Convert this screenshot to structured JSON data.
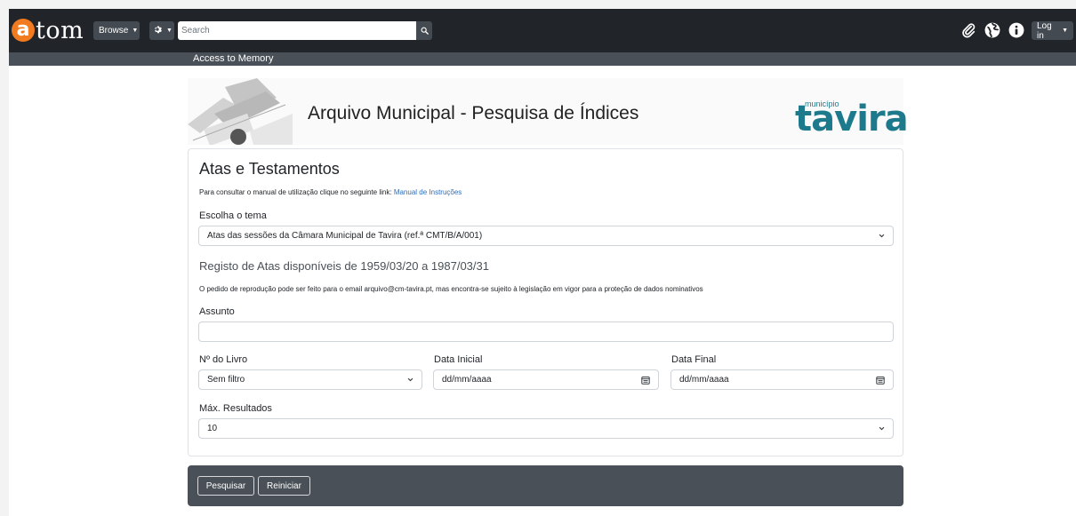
{
  "navbar": {
    "logo_letter": "a",
    "logo_text": "tom",
    "browse_label": "Browse",
    "search_placeholder": "Search",
    "login_label": "Log in",
    "icons": [
      "gear-icon",
      "search-icon",
      "paperclip-icon",
      "globe-icon",
      "info-icon"
    ],
    "background": "#212529"
  },
  "subbar": {
    "text": "Access to Memory"
  },
  "banner": {
    "title": "Arquivo Municipal - Pesquisa de Índices",
    "logo_small": "município",
    "logo_large": "tavira",
    "logo_color": "#1d7a8c"
  },
  "form": {
    "heading": "Atas e Testamentos",
    "manual_text": "Para consultar o manual de utilização clique no seguinte link:",
    "manual_link": "Manual de Instruções",
    "tema_label": "Escolha o tema",
    "tema_value": "Atas das sessões da Câmara Municipal de Tavira (ref.ª CMT/B/A/001)",
    "registo_text": "Registo de Atas disponíveis de 1959/03/20 a 1987/03/31",
    "pedido_text": "O pedido de reprodução pode ser feito para o email arquivo@cm-tavira.pt, mas encontra-se sujeito à legislação em vigor para a proteção de dados nominativos",
    "assunto_label": "Assunto",
    "assunto_value": "",
    "livro_label": "Nº do Livro",
    "livro_value": "Sem filtro",
    "data_inicial_label": "Data Inicial",
    "data_inicial_value": "dd/mm/aaaa",
    "data_final_label": "Data Final",
    "data_final_value": "dd/mm/aaaa",
    "max_label": "Máx. Resultados",
    "max_value": "10"
  },
  "footer": {
    "search_button": "Pesquisar",
    "reset_button": "Reiniciar"
  }
}
